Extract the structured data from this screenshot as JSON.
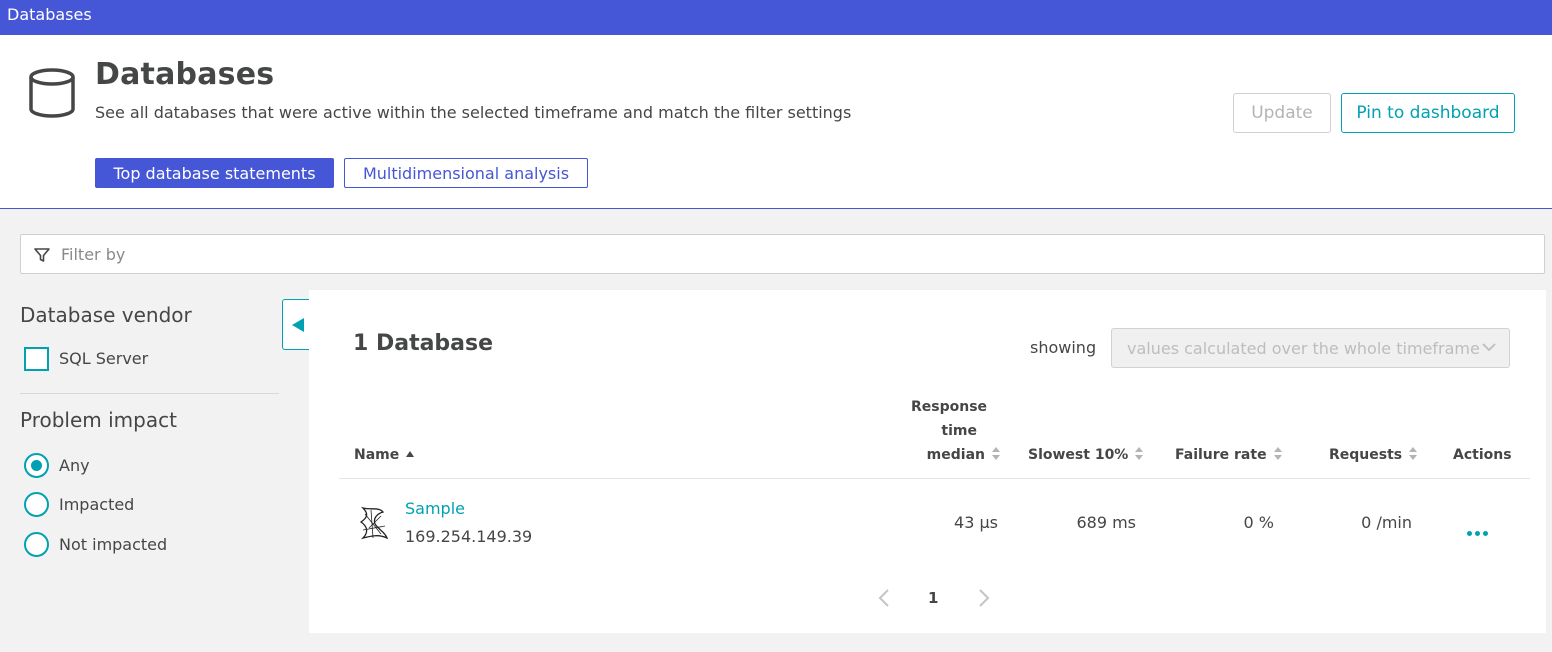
{
  "topbar": {
    "title": "Databases"
  },
  "header": {
    "title": "Databases",
    "subtitle": "See all databases that were active within the selected timeframe and match the filter settings",
    "icon": "database-icon",
    "update_label": "Update",
    "pin_label": "Pin to dashboard",
    "top_statements_label": "Top database statements",
    "multidim_label": "Multidimensional analysis"
  },
  "filter": {
    "placeholder": "Filter by",
    "icon": "filter-icon"
  },
  "sidebar": {
    "vendor_heading": "Database vendor",
    "vendors": [
      {
        "label": "SQL Server",
        "checked": false
      }
    ],
    "impact_heading": "Problem impact",
    "impact_options": [
      {
        "label": "Any",
        "selected": true
      },
      {
        "label": "Impacted",
        "selected": false
      },
      {
        "label": "Not impacted",
        "selected": false
      }
    ]
  },
  "main": {
    "count_title": "1 Database",
    "showing_label": "showing",
    "showing_select": "values calculated over the whole timeframe",
    "columns": {
      "name": "Name",
      "response_line1": "Response",
      "response_line2": "time",
      "response_line3": "median",
      "slowest": "Slowest 10%",
      "failure": "Failure rate",
      "requests": "Requests",
      "actions": "Actions"
    },
    "rows": [
      {
        "name": "Sample",
        "host": "169.254.149.39",
        "response_median": "43 µs",
        "slowest": "689 ms",
        "failure_rate": "0 %",
        "requests": "0 /min"
      }
    ],
    "pagination": {
      "current": "1"
    }
  },
  "colors": {
    "brand": "#4556d7",
    "accent": "#00a1b2",
    "text": "#454646"
  }
}
